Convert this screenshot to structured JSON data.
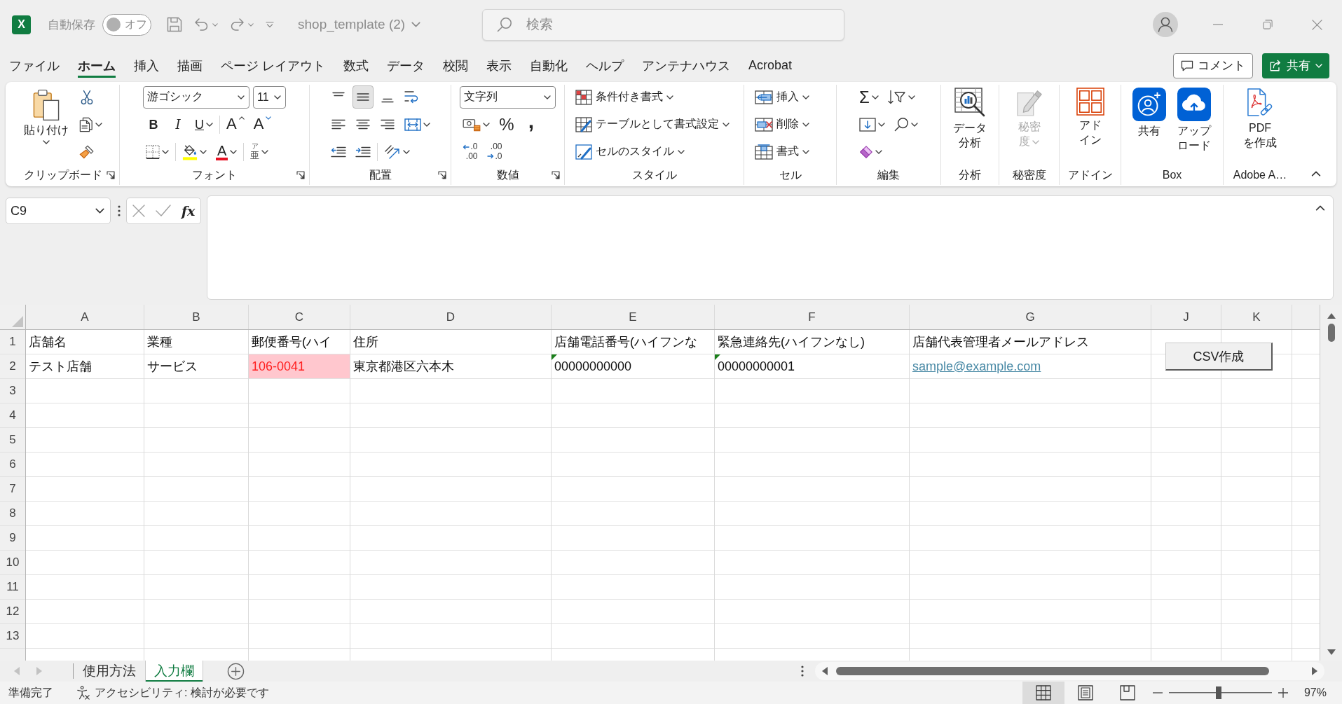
{
  "window": {
    "logo": "X",
    "autosave": {
      "label": "自動保存",
      "on": false,
      "state_label": "オフ"
    },
    "title": "shop_template (2)",
    "search": {
      "placeholder": "検索"
    }
  },
  "menu": {
    "tabs": [
      {
        "label": "ファイル",
        "selected": false
      },
      {
        "label": "ホーム",
        "selected": true
      },
      {
        "label": "挿入",
        "selected": false
      },
      {
        "label": "描画",
        "selected": false
      },
      {
        "label": "ページ レイアウト",
        "selected": false
      },
      {
        "label": "数式",
        "selected": false
      },
      {
        "label": "データ",
        "selected": false
      },
      {
        "label": "校閲",
        "selected": false
      },
      {
        "label": "表示",
        "selected": false
      },
      {
        "label": "自動化",
        "selected": false
      },
      {
        "label": "ヘルプ",
        "selected": false
      },
      {
        "label": "アンテナハウス",
        "selected": false
      },
      {
        "label": "Acrobat",
        "selected": false
      }
    ],
    "comment_button": "コメント",
    "share_button": "共有"
  },
  "ribbon": {
    "groups": [
      {
        "kind": "clipboard",
        "label": "クリップボード",
        "launcher": true,
        "large": [
          {
            "kind": "paste",
            "label": "貼り付け",
            "dropdown": true
          }
        ],
        "rows": [
          {
            "controls": [
              {
                "kind": "cut",
                "dropdown": false
              }
            ]
          },
          {
            "controls": [
              {
                "kind": "copy",
                "dropdown": true
              }
            ]
          },
          {
            "controls": [
              {
                "kind": "format-painter",
                "dropdown": false
              }
            ]
          }
        ]
      },
      {
        "kind": "font",
        "label": "フォント",
        "launcher": true,
        "rows": [
          {
            "controls": [
              {
                "kind": "font-name",
                "value": "游ゴシック",
                "dropdown": true
              },
              {
                "kind": "font-size",
                "value": "11",
                "dropdown": true
              }
            ]
          },
          {
            "controls": [
              {
                "kind": "bold",
                "label": "B",
                "selected": false,
                "dropdown": false
              },
              {
                "kind": "italic",
                "label": "I",
                "selected": false,
                "dropdown": false
              },
              {
                "kind": "underline",
                "label": "U",
                "selected": false,
                "dropdown": true
              },
              {
                "kind": "separator"
              },
              {
                "kind": "grow-font",
                "label": "A",
                "dropdown": false
              },
              {
                "kind": "shrink-font",
                "label": "A",
                "dropdown": false
              }
            ]
          },
          {
            "controls": [
              {
                "kind": "borders",
                "dropdown": true
              },
              {
                "kind": "separator"
              },
              {
                "kind": "fill-color",
                "dropdown": true
              },
              {
                "kind": "font-color",
                "label": "A",
                "dropdown": true
              },
              {
                "kind": "separator"
              },
              {
                "kind": "phonetic",
                "ruby": "ア",
                "base": "亜",
                "dropdown": true
              }
            ]
          }
        ]
      },
      {
        "kind": "alignment",
        "label": "配置",
        "launcher": true,
        "rows": [
          {
            "controls": [
              {
                "kind": "top-align",
                "selected": false,
                "dropdown": false
              },
              {
                "kind": "middle-align",
                "selected": true,
                "dropdown": false
              },
              {
                "kind": "bottom-align",
                "selected": false,
                "dropdown": false
              },
              {
                "kind": "wrap-text",
                "selected": false,
                "dropdown": false
              }
            ]
          },
          {
            "controls": [
              {
                "kind": "align-left",
                "selected": false,
                "dropdown": false
              },
              {
                "kind": "align-center",
                "selected": false,
                "dropdown": false
              },
              {
                "kind": "align-right",
                "selected": false,
                "dropdown": false
              },
              {
                "kind": "merge",
                "selected": false,
                "dropdown": true
              }
            ]
          },
          {
            "controls": [
              {
                "kind": "decrease-indent",
                "dropdown": false
              },
              {
                "kind": "increase-indent",
                "dropdown": false
              },
              {
                "kind": "separator"
              },
              {
                "kind": "orientation",
                "dropdown": true
              }
            ]
          }
        ]
      },
      {
        "kind": "number",
        "label": "数値",
        "launcher": true,
        "rows": [
          {
            "controls": [
              {
                "kind": "number-format",
                "value": "文字列",
                "dropdown": true
              }
            ]
          },
          {
            "controls": [
              {
                "kind": "accounting",
                "dropdown": true
              },
              {
                "kind": "percent",
                "label": "%",
                "dropdown": false
              },
              {
                "kind": "comma",
                "label": ",",
                "dropdown": false
              }
            ]
          },
          {
            "controls": [
              {
                "kind": "increase-decimal",
                "lines": [
                  ".0",
                  ".00"
                ],
                "dropdown": false
              },
              {
                "kind": "decrease-decimal",
                "lines": [
                  ".00",
                  ".0"
                ],
                "dropdown": false
              }
            ]
          }
        ]
      },
      {
        "kind": "styles",
        "label": "スタイル",
        "launcher": false,
        "rows": [
          {
            "controls": [
              {
                "kind": "conditional-format",
                "label": "条件付き書式",
                "dropdown": true
              }
            ]
          },
          {
            "controls": [
              {
                "kind": "format-as-table",
                "label": "テーブルとして書式設定",
                "dropdown": true
              }
            ]
          },
          {
            "controls": [
              {
                "kind": "cell-styles",
                "label": "セルのスタイル",
                "dropdown": true
              }
            ]
          }
        ]
      },
      {
        "kind": "cells",
        "label": "セル",
        "launcher": false,
        "rows": [
          {
            "controls": [
              {
                "kind": "insert-cells",
                "label": "挿入",
                "dropdown": true
              }
            ]
          },
          {
            "controls": [
              {
                "kind": "delete-cells",
                "label": "削除",
                "dropdown": true
              }
            ]
          },
          {
            "controls": [
              {
                "kind": "format-cells",
                "label": "書式",
                "dropdown": true
              }
            ]
          }
        ]
      },
      {
        "kind": "editing",
        "label": "編集",
        "launcher": false,
        "rows": [
          {
            "controls": [
              {
                "kind": "autosum",
                "label": "Σ",
                "dropdown": true
              },
              {
                "kind": "sort-filter",
                "dropdown": true
              }
            ]
          },
          {
            "controls": [
              {
                "kind": "fill",
                "dropdown": true
              },
              {
                "kind": "find",
                "dropdown": true
              }
            ]
          },
          {
            "controls": [
              {
                "kind": "clear",
                "dropdown": true
              }
            ]
          }
        ]
      },
      {
        "kind": "analysis",
        "label": "分析",
        "launcher": false,
        "large": [
          {
            "kind": "data-analysis",
            "label": "データ分析",
            "dropdown": false
          }
        ]
      },
      {
        "kind": "sensitivity",
        "label": "秘密度",
        "launcher": false,
        "large": [
          {
            "kind": "sensitivity",
            "label": "秘密度",
            "dropdown": true,
            "disabled": true
          }
        ]
      },
      {
        "kind": "addins",
        "label": "アドイン",
        "launcher": false,
        "large": [
          {
            "kind": "add-ins",
            "label": "アドイン",
            "dropdown": false
          }
        ]
      },
      {
        "kind": "box",
        "label": "Box",
        "launcher": false,
        "large": [
          {
            "kind": "box-share",
            "label": "共有",
            "dropdown": false
          },
          {
            "kind": "box-upload",
            "label": "アップロード",
            "dropdown": false
          }
        ]
      },
      {
        "kind": "adobe",
        "label": "Adobe A…",
        "launcher": false,
        "large": [
          {
            "kind": "create-pdf",
            "label": "PDF\nを作成",
            "dropdown": false
          }
        ]
      }
    ]
  },
  "formula_bar": {
    "name_box": "C9",
    "function_button": "fx"
  },
  "sheet": {
    "columns": [
      "A",
      "B",
      "C",
      "D",
      "E",
      "F",
      "G",
      "J",
      "K"
    ],
    "rows": [
      {
        "number": "1",
        "cells": [
          {
            "kind": "text",
            "text": "店舗名",
            "highlighted": false,
            "error_flag": false
          },
          {
            "kind": "text",
            "text": "業種",
            "highlighted": false,
            "error_flag": false
          },
          {
            "kind": "text",
            "text": "郵便番号(ハイ",
            "highlighted": false,
            "error_flag": false
          },
          {
            "kind": "text",
            "text": "住所",
            "highlighted": false,
            "error_flag": false
          },
          {
            "kind": "text",
            "text": "店舗電話番号(ハイフンな",
            "highlighted": false,
            "error_flag": false
          },
          {
            "kind": "text",
            "text": "緊急連絡先(ハイフンなし)",
            "highlighted": false,
            "error_flag": false
          },
          {
            "kind": "text",
            "text": "店舗代表管理者メールアドレス",
            "highlighted": false,
            "error_flag": false
          }
        ]
      },
      {
        "number": "2",
        "cells": [
          {
            "kind": "text",
            "text": "テスト店舗",
            "highlighted": false,
            "error_flag": false
          },
          {
            "kind": "text",
            "text": "サービス",
            "highlighted": false,
            "error_flag": false
          },
          {
            "kind": "text",
            "text": "106-0041",
            "highlighted": true,
            "error_flag": false
          },
          {
            "kind": "text",
            "text": "東京都港区六本木",
            "highlighted": false,
            "error_flag": false
          },
          {
            "kind": "text",
            "text": "00000000000",
            "highlighted": false,
            "error_flag": true
          },
          {
            "kind": "text",
            "text": "00000000001",
            "highlighted": false,
            "error_flag": true
          },
          {
            "kind": "link",
            "text": "sample@example.com",
            "highlighted": false,
            "error_flag": false
          }
        ]
      },
      {
        "number": "3"
      },
      {
        "number": "4"
      },
      {
        "number": "5"
      },
      {
        "number": "6"
      },
      {
        "number": "7"
      },
      {
        "number": "8"
      },
      {
        "number": "9"
      },
      {
        "number": "10"
      },
      {
        "number": "11"
      },
      {
        "number": "12"
      },
      {
        "number": "13"
      }
    ],
    "buttons": [
      {
        "label": "CSV作成"
      }
    ]
  },
  "sheet_tabs": [
    {
      "label": "使用方法",
      "selected": false
    },
    {
      "label": "入力欄",
      "selected": true
    }
  ],
  "status_bar": {
    "ready": "準備完了",
    "accessibility": "アクセシビリティ: 検討が必要です",
    "views": [
      {
        "kind": "normal",
        "selected": true
      },
      {
        "kind": "page-layout",
        "selected": false
      },
      {
        "kind": "page-break",
        "selected": false
      }
    ],
    "zoom": {
      "level": 0.48,
      "reading": "97%"
    }
  }
}
